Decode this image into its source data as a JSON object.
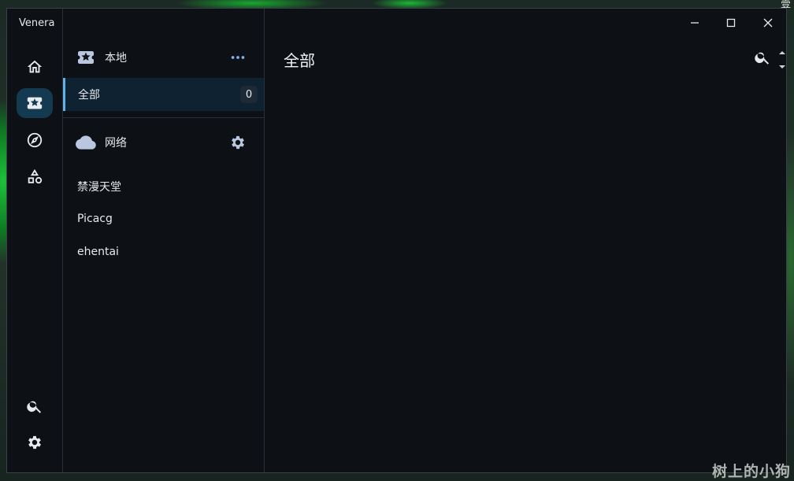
{
  "window": {
    "app_title": "Venera",
    "background_corner_text": "壹",
    "watermark": "树上的小狗"
  },
  "rail": {
    "items": [
      {
        "icon": "home-icon",
        "active": false
      },
      {
        "icon": "favorite-ticket-icon",
        "active": true
      },
      {
        "icon": "explore-compass-icon",
        "active": false
      },
      {
        "icon": "categories-icon",
        "active": false
      }
    ],
    "bottom_items": [
      {
        "icon": "search-icon"
      },
      {
        "icon": "settings-gear-icon"
      }
    ]
  },
  "sidebar": {
    "local_section": {
      "label": "本地",
      "icon": "favorite-ticket-icon",
      "action_icon": "more-dots-icon"
    },
    "all_item": {
      "label": "全部",
      "count": "0"
    },
    "network_section": {
      "label": "网络",
      "icon": "cloud-icon",
      "action_icon": "settings-gear-icon"
    },
    "sources": [
      "禁漫天堂",
      "Picacg",
      "ehentai"
    ]
  },
  "main": {
    "title": "全部"
  },
  "colors": {
    "window_bg": "#0d1115",
    "active_rail_bg": "#143a52",
    "active_item_bg": "#0f2231",
    "accent": "#5fb3e6",
    "icon_tint": "#b9c7e0"
  }
}
